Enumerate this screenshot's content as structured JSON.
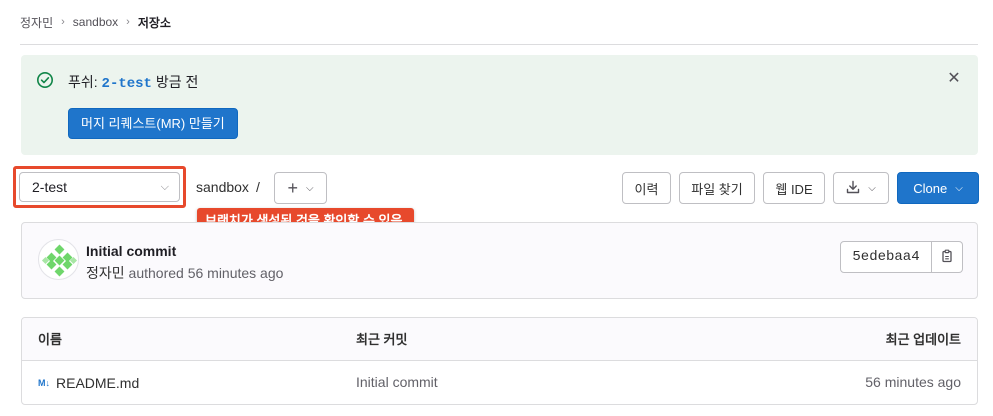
{
  "breadcrumb": {
    "user": "정자민",
    "project": "sandbox",
    "current": "저장소"
  },
  "alert": {
    "prefix": "푸쉬: ",
    "branch": "2-test",
    "suffix": " 방금 전",
    "button": "머지 리퀘스트(MR) 만들기",
    "icons": {
      "status": "check-circle-icon",
      "close": "close-icon"
    }
  },
  "repo": {
    "branch_selected": "2-test",
    "path": "sandbox",
    "path_sep": "/",
    "buttons": {
      "history": "이력",
      "find_file": "파일 찾기",
      "web_ide": "웹 IDE",
      "clone": "Clone"
    }
  },
  "annotation": "브랜치가 생성된 것을 확인할 수 있음.",
  "commit": {
    "title": "Initial commit",
    "author": "정자민",
    "meta": " authored 56 minutes ago",
    "sha": "5edebaa4"
  },
  "table": {
    "headers": [
      "이름",
      "최근 커밋",
      "최근 업데이트"
    ],
    "rows": [
      {
        "name": "README.md",
        "commit": "Initial commit",
        "updated": "56 minutes ago"
      }
    ]
  },
  "colors": {
    "accent": "#1f75cb",
    "highlight": "#e7492c",
    "alert_bg": "#ecf4ee",
    "success": "#108548"
  }
}
